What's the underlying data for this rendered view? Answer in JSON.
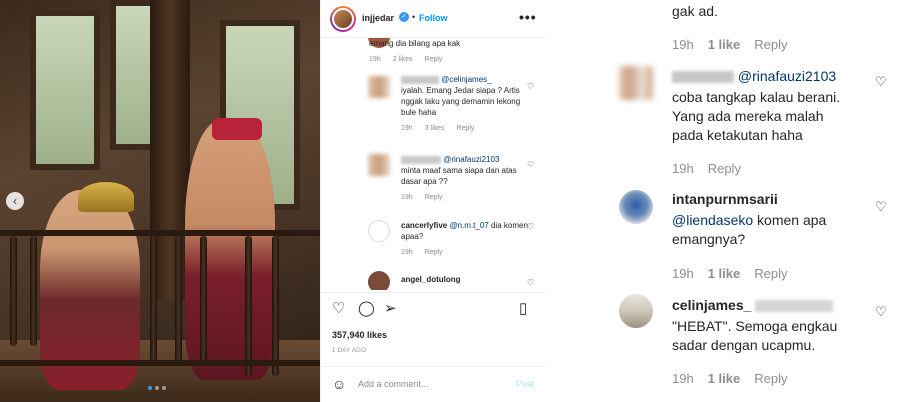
{
  "post": {
    "username": "injjedar",
    "follow_label": "Follow",
    "separator": "•",
    "likes": "357,940 likes",
    "date": "1 DAY AGO",
    "add_comment_placeholder": "Add a comment...",
    "post_label": "Post",
    "carousel_prev": "‹",
    "icons": [
      "heart-outline-icon",
      "comment-bubble-icon",
      "share-plane-icon",
      "bookmark-icon",
      "emoji-icon",
      "more-dots-icon"
    ],
    "comments": [
      {
        "text": "emang dia bilang apa kak",
        "time": "19h",
        "likes": "2 likes",
        "reply": "Reply"
      },
      {
        "mention": "@celinjames_",
        "text": "iyalah. Emang Jedar siapa ? Artis nggak laku yang demamin lekong bule haha",
        "time": "19h",
        "likes": "3 likes",
        "reply": "Reply"
      },
      {
        "mention": "@rinafauzi2103",
        "text": "minta maaf sama siapa dan atas dasar apa ??",
        "time": "19h",
        "reply": "Reply"
      },
      {
        "username": "cancerlyfive",
        "mention": "@n.m.t_07",
        "text": "dia komen apaa?",
        "time": "19h",
        "reply": "Reply"
      },
      {
        "username": "angel_dotulong"
      }
    ]
  },
  "zoom": {
    "top_text": "gak ad.",
    "top_meta": {
      "time": "19h",
      "likes": "1 like",
      "reply": "Reply"
    },
    "comments": [
      {
        "mention": "@rinafauzi2103",
        "text_lines": [
          "coba tangkap kalau berani.",
          "Yang ada mereka malah",
          "pada ketakutan haha"
        ],
        "time": "19h",
        "reply": "Reply"
      },
      {
        "username": "intanpurnmsarii",
        "mention": "@liendaseko",
        "text_after_mention": "komen apa",
        "text_line2": "emangnya?",
        "time": "19h",
        "likes": "1 like",
        "reply": "Reply"
      },
      {
        "username": "celinjames_",
        "text_lines": [
          "\"HEBAT\". Semoga engkau",
          "sadar dengan ucapmu."
        ],
        "time": "19h",
        "likes": "1 like",
        "reply": "Reply"
      }
    ]
  },
  "colors": {
    "link_blue": "#0095f6",
    "mention": "#00376b",
    "muted": "#8e8e8e",
    "post_disabled": "#b2dffc"
  }
}
